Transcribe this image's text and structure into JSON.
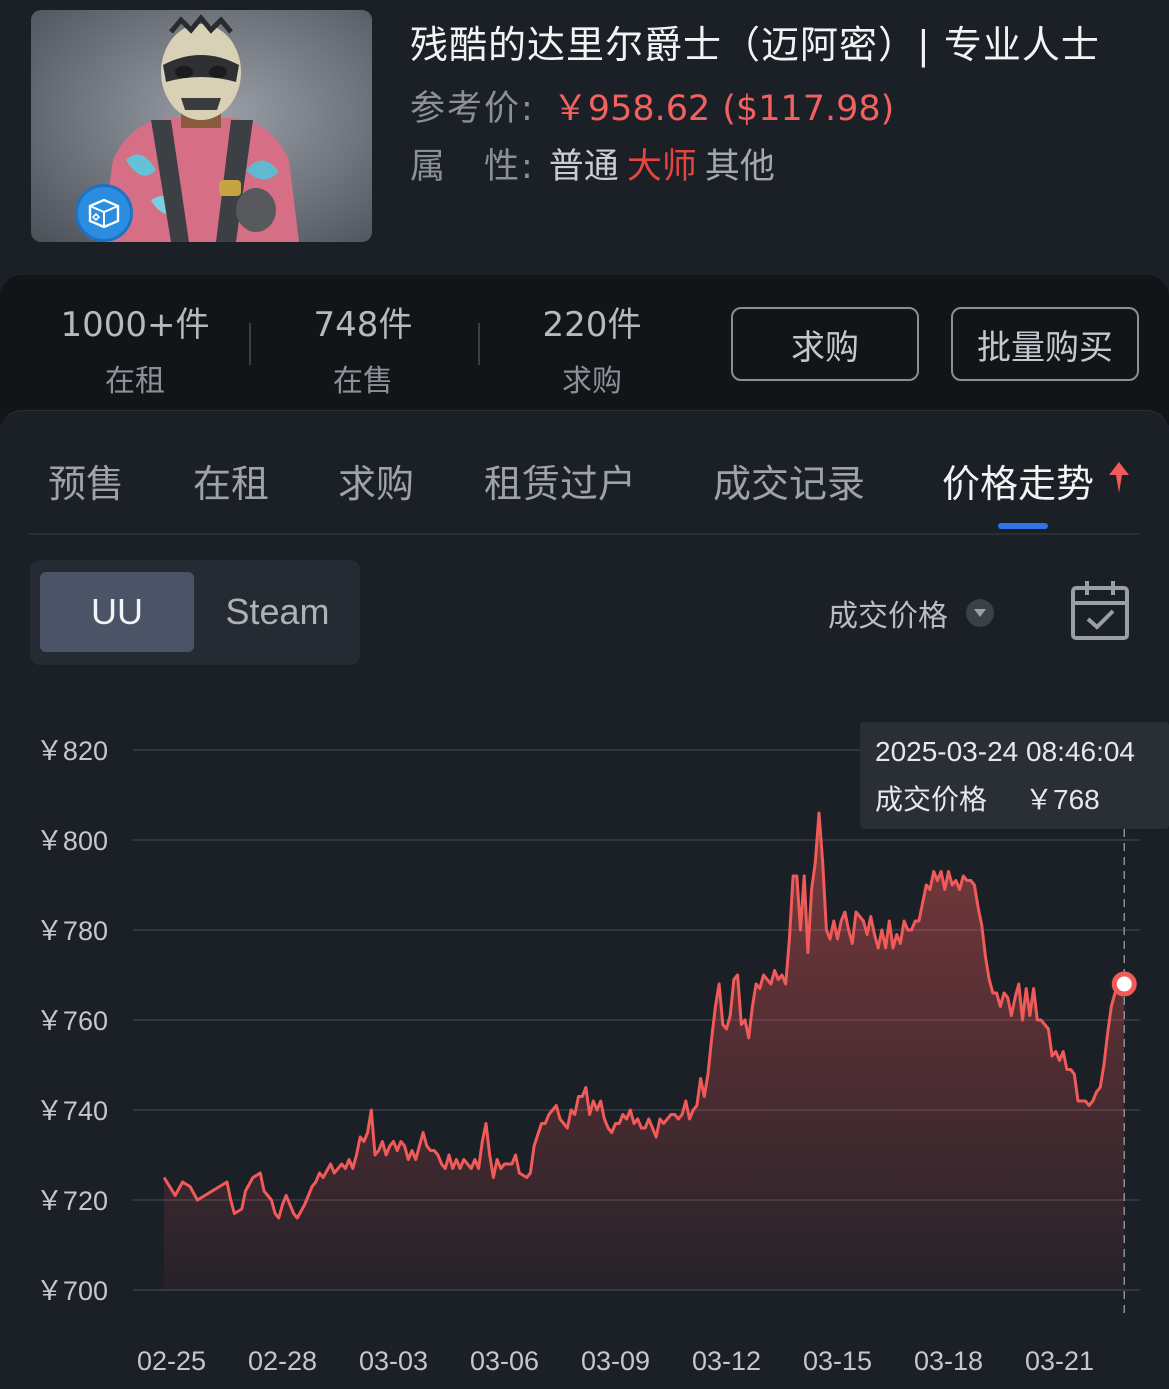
{
  "item": {
    "title": "残酷的达里尔爵士（迈阿密）| 专业人士",
    "price_label": "参考价:",
    "price_cny": "￥958.62",
    "price_usd": "($117.98)",
    "attr_label": "属　性:",
    "tags": [
      "普通",
      "大师",
      "其他"
    ],
    "badge_icon": "box-icon"
  },
  "stats": [
    {
      "num": "1000+件",
      "label": "在租"
    },
    {
      "num": "748件",
      "label": "在售"
    },
    {
      "num": "220件",
      "label": "求购"
    }
  ],
  "actions": {
    "want_buy": "求购",
    "bulk_buy": "批量购买"
  },
  "tabs": [
    "预售",
    "在租",
    "求购",
    "租赁过户",
    "成交记录",
    "价格走势"
  ],
  "active_tab": "价格走势",
  "source_toggle": {
    "options": [
      "UU",
      "Steam"
    ],
    "selected": "UU"
  },
  "metric_select": "成交价格",
  "tooltip": {
    "datetime": "2025-03-24 08:46:04",
    "label": "成交价格",
    "value": "￥768"
  },
  "colors": {
    "line": "#f05a59",
    "accent": "#2e76e6",
    "price": "#f0615f",
    "tag_master": "#e8443f"
  },
  "chart_data": {
    "type": "area",
    "y_ticks": [
      "￥820",
      "￥800",
      "￥780",
      "￥760",
      "￥740",
      "￥720",
      "￥700"
    ],
    "ylim": [
      700,
      820
    ],
    "x_ticks": [
      "02-25",
      "02-28",
      "03-03",
      "03-06",
      "03-09",
      "03-12",
      "03-15",
      "03-18",
      "03-21"
    ],
    "x_range_days": [
      0,
      27.4
    ],
    "x_tick_days": [
      0,
      3,
      6,
      9,
      12,
      15,
      18,
      21,
      24
    ],
    "series": [
      {
        "values": [
          [
            -0.2,
            725
          ],
          [
            0.1,
            721
          ],
          [
            0.3,
            724
          ],
          [
            0.5,
            723
          ],
          [
            0.7,
            720
          ],
          [
            0.9,
            721
          ],
          [
            1.1,
            722
          ],
          [
            1.3,
            723
          ],
          [
            1.5,
            724
          ],
          [
            1.6,
            720
          ],
          [
            1.7,
            717
          ],
          [
            1.9,
            718
          ],
          [
            2.0,
            722
          ],
          [
            2.2,
            725
          ],
          [
            2.4,
            726
          ],
          [
            2.5,
            722
          ],
          [
            2.7,
            720
          ],
          [
            2.8,
            717
          ],
          [
            2.9,
            716
          ],
          [
            3.0,
            719
          ],
          [
            3.1,
            721
          ],
          [
            3.2,
            719
          ],
          [
            3.3,
            717
          ],
          [
            3.4,
            716
          ],
          [
            3.6,
            719
          ],
          [
            3.8,
            723
          ],
          [
            3.9,
            724
          ],
          [
            4.0,
            726
          ],
          [
            4.1,
            725
          ],
          [
            4.3,
            728
          ],
          [
            4.4,
            726
          ],
          [
            4.5,
            727
          ],
          [
            4.6,
            728
          ],
          [
            4.7,
            727
          ],
          [
            4.8,
            729
          ],
          [
            4.9,
            727
          ],
          [
            5.0,
            730
          ],
          [
            5.1,
            734
          ],
          [
            5.2,
            733
          ],
          [
            5.3,
            735
          ],
          [
            5.4,
            740
          ],
          [
            5.5,
            730
          ],
          [
            5.6,
            731
          ],
          [
            5.7,
            733
          ],
          [
            5.8,
            730
          ],
          [
            5.9,
            732
          ],
          [
            6.0,
            733
          ],
          [
            6.1,
            731
          ],
          [
            6.2,
            733
          ],
          [
            6.3,
            732
          ],
          [
            6.4,
            729
          ],
          [
            6.5,
            731
          ],
          [
            6.6,
            729
          ],
          [
            6.7,
            732
          ],
          [
            6.8,
            735
          ],
          [
            6.9,
            732
          ],
          [
            7.0,
            731
          ],
          [
            7.1,
            731
          ],
          [
            7.2,
            730
          ],
          [
            7.3,
            728
          ],
          [
            7.4,
            727
          ],
          [
            7.5,
            730
          ],
          [
            7.6,
            727
          ],
          [
            7.7,
            729
          ],
          [
            7.8,
            727
          ],
          [
            7.9,
            729
          ],
          [
            8.0,
            728
          ],
          [
            8.1,
            727
          ],
          [
            8.2,
            729
          ],
          [
            8.3,
            727
          ],
          [
            8.4,
            733
          ],
          [
            8.5,
            737
          ],
          [
            8.6,
            730
          ],
          [
            8.7,
            725
          ],
          [
            8.8,
            729
          ],
          [
            8.9,
            727
          ],
          [
            9.0,
            728
          ],
          [
            9.1,
            728
          ],
          [
            9.2,
            728
          ],
          [
            9.3,
            730
          ],
          [
            9.4,
            726
          ],
          [
            9.6,
            725
          ],
          [
            9.7,
            726
          ],
          [
            9.8,
            732
          ],
          [
            10.0,
            737
          ],
          [
            10.1,
            737
          ],
          [
            10.2,
            739
          ],
          [
            10.4,
            741
          ],
          [
            10.5,
            738
          ],
          [
            10.7,
            736
          ],
          [
            10.8,
            740
          ],
          [
            10.9,
            739
          ],
          [
            11.0,
            743
          ],
          [
            11.1,
            743
          ],
          [
            11.2,
            745
          ],
          [
            11.3,
            739
          ],
          [
            11.4,
            742
          ],
          [
            11.5,
            740
          ],
          [
            11.6,
            742
          ],
          [
            11.7,
            738
          ],
          [
            11.8,
            736
          ],
          [
            11.9,
            735
          ],
          [
            12.0,
            737
          ],
          [
            12.1,
            737
          ],
          [
            12.2,
            739
          ],
          [
            12.3,
            738
          ],
          [
            12.4,
            740
          ],
          [
            12.5,
            737
          ],
          [
            12.6,
            738
          ],
          [
            12.7,
            736
          ],
          [
            12.8,
            736
          ],
          [
            12.9,
            738
          ],
          [
            13.0,
            736
          ],
          [
            13.1,
            734
          ],
          [
            13.2,
            738
          ],
          [
            13.3,
            737
          ],
          [
            13.4,
            738
          ],
          [
            13.5,
            739
          ],
          [
            13.6,
            739
          ],
          [
            13.7,
            738
          ],
          [
            13.8,
            739
          ],
          [
            13.9,
            742
          ],
          [
            14.0,
            738
          ],
          [
            14.1,
            740
          ],
          [
            14.2,
            741
          ],
          [
            14.3,
            747
          ],
          [
            14.4,
            743
          ],
          [
            14.5,
            748
          ],
          [
            14.6,
            756
          ],
          [
            14.7,
            763
          ],
          [
            14.8,
            768
          ],
          [
            14.9,
            759
          ],
          [
            15.0,
            758
          ],
          [
            15.1,
            761
          ],
          [
            15.2,
            769
          ],
          [
            15.3,
            770
          ],
          [
            15.4,
            759
          ],
          [
            15.5,
            760
          ],
          [
            15.6,
            756
          ],
          [
            15.7,
            763
          ],
          [
            15.8,
            768
          ],
          [
            15.9,
            767
          ],
          [
            16.0,
            770
          ],
          [
            16.1,
            769
          ],
          [
            16.2,
            768
          ],
          [
            16.3,
            771
          ],
          [
            16.4,
            769
          ],
          [
            16.5,
            770
          ],
          [
            16.6,
            768
          ],
          [
            16.7,
            778
          ],
          [
            16.8,
            792
          ],
          [
            16.9,
            792
          ],
          [
            17.0,
            780
          ],
          [
            17.1,
            792
          ],
          [
            17.2,
            775
          ],
          [
            17.3,
            789
          ],
          [
            17.4,
            795
          ],
          [
            17.5,
            806
          ],
          [
            17.6,
            795
          ],
          [
            17.7,
            780
          ],
          [
            17.8,
            778
          ],
          [
            17.9,
            782
          ],
          [
            18.0,
            778
          ],
          [
            18.1,
            782
          ],
          [
            18.2,
            784
          ],
          [
            18.3,
            780
          ],
          [
            18.4,
            777
          ],
          [
            18.5,
            784
          ],
          [
            18.6,
            783
          ],
          [
            18.7,
            782
          ],
          [
            18.8,
            779
          ],
          [
            18.9,
            783
          ],
          [
            19.0,
            779
          ],
          [
            19.1,
            776
          ],
          [
            19.2,
            780
          ],
          [
            19.3,
            776
          ],
          [
            19.4,
            782
          ],
          [
            19.5,
            776
          ],
          [
            19.6,
            779
          ],
          [
            19.7,
            777
          ],
          [
            19.8,
            782
          ],
          [
            19.9,
            780
          ],
          [
            20.0,
            780
          ],
          [
            20.1,
            782
          ],
          [
            20.2,
            782
          ],
          [
            20.3,
            786
          ],
          [
            20.4,
            790
          ],
          [
            20.5,
            789
          ],
          [
            20.6,
            793
          ],
          [
            20.7,
            791
          ],
          [
            20.8,
            793
          ],
          [
            20.9,
            789
          ],
          [
            21.0,
            793
          ],
          [
            21.1,
            790
          ],
          [
            21.2,
            791
          ],
          [
            21.3,
            789
          ],
          [
            21.4,
            792
          ],
          [
            21.5,
            791
          ],
          [
            21.6,
            791
          ],
          [
            21.7,
            790
          ],
          [
            21.8,
            785
          ],
          [
            21.9,
            781
          ],
          [
            22.0,
            774
          ],
          [
            22.1,
            769
          ],
          [
            22.2,
            766
          ],
          [
            22.3,
            766
          ],
          [
            22.4,
            763
          ],
          [
            22.5,
            766
          ],
          [
            22.6,
            765
          ],
          [
            22.7,
            761
          ],
          [
            22.8,
            765
          ],
          [
            22.9,
            768
          ],
          [
            23.0,
            760
          ],
          [
            23.1,
            767
          ],
          [
            23.2,
            761
          ],
          [
            23.3,
            767
          ],
          [
            23.4,
            760
          ],
          [
            23.5,
            760
          ],
          [
            23.6,
            759
          ],
          [
            23.7,
            758
          ],
          [
            23.8,
            752
          ],
          [
            23.9,
            753
          ],
          [
            24.0,
            751
          ],
          [
            24.1,
            753
          ],
          [
            24.2,
            749
          ],
          [
            24.3,
            749
          ],
          [
            24.4,
            748
          ],
          [
            24.5,
            742
          ],
          [
            24.6,
            742
          ],
          [
            24.7,
            742
          ],
          [
            24.8,
            741
          ],
          [
            24.9,
            742
          ],
          [
            25.0,
            744
          ],
          [
            25.1,
            745
          ],
          [
            25.2,
            750
          ],
          [
            25.3,
            757
          ],
          [
            25.4,
            763
          ],
          [
            25.5,
            766
          ],
          [
            25.6,
            768
          ],
          [
            25.75,
            768
          ]
        ]
      }
    ],
    "highlight_point": [
      25.75,
      768
    ],
    "grid": true
  }
}
